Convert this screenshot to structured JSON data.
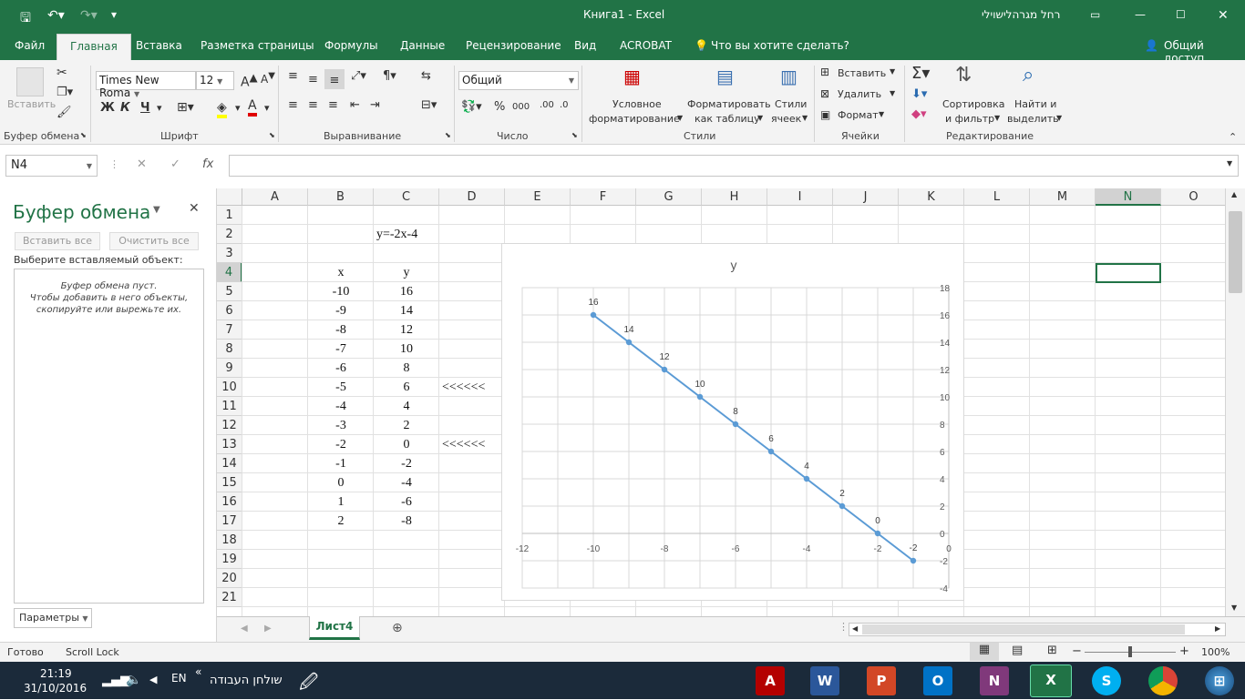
{
  "titlebar": {
    "title": "Книга1  -  Excel",
    "user": "רחל מגרהלישוילי"
  },
  "tabs": [
    "Файл",
    "Главная",
    "Вставка",
    "Разметка страницы",
    "Формулы",
    "Данные",
    "Рецензирование",
    "Вид",
    "ACROBAT"
  ],
  "tell_me": "Что вы хотите сделать?",
  "share": "Общий доступ",
  "ribbon": {
    "paste": "Вставить",
    "font_name": "Times New Roma",
    "font_size": "12",
    "bold": "Ж",
    "italic": "К",
    "underline": "Ч",
    "number_format": "Общий",
    "cond_format_1": "Условное",
    "cond_format_2": "форматирование",
    "format_table_1": "Форматировать",
    "format_table_2": "как таблицу",
    "cell_styles_1": "Стили",
    "cell_styles_2": "ячеек",
    "insert": "Вставить",
    "delete": "Удалить",
    "format": "Формат",
    "sort_1": "Сортировка",
    "sort_2": "и фильтр",
    "find_1": "Найти и",
    "find_2": "выделить",
    "groups": {
      "clipboard": "Буфер обмена",
      "font": "Шрифт",
      "alignment": "Выравнивание",
      "number": "Число",
      "styles": "Стили",
      "cells": "Ячейки",
      "editing": "Редактирование"
    }
  },
  "formula_bar": {
    "name_box": "N4",
    "fx": "fx"
  },
  "pane": {
    "title": "Буфер обмена",
    "paste_all": "Вставить все",
    "clear_all": "Очистить все",
    "choose": "Выберите вставляемый объект:",
    "empty_1": "Буфер обмена пуст.",
    "empty_2": "Чтобы добавить в него объекты,",
    "empty_3": "скопируйте или вырежьте их.",
    "options": "Параметры"
  },
  "columns": [
    "A",
    "B",
    "C",
    "D",
    "E",
    "F",
    "G",
    "H",
    "I",
    "J",
    "K",
    "L",
    "M",
    "N",
    "O"
  ],
  "rows": [
    "1",
    "2",
    "3",
    "4",
    "5",
    "6",
    "7",
    "8",
    "9",
    "10",
    "11",
    "12",
    "13",
    "14",
    "15",
    "16",
    "17",
    "18",
    "19",
    "20",
    "21"
  ],
  "cells": {
    "C2": "y=-2x-4",
    "B4": "x",
    "C4": "y",
    "x_values": [
      "-10",
      "-9",
      "-8",
      "-7",
      "-6",
      "-5",
      "-4",
      "-3",
      "-2",
      "-1",
      "0",
      "1",
      "2"
    ],
    "y_values": [
      "16",
      "14",
      "12",
      "10",
      "8",
      "6",
      "4",
      "2",
      "0",
      "-2",
      "-4",
      "-6",
      "-8"
    ],
    "D10": "<<<<<<",
    "D13": "<<<<<<"
  },
  "chart_data": {
    "type": "line",
    "title": "y",
    "x": [
      -10,
      -9,
      -8,
      -7,
      -6,
      -5,
      -4,
      -3,
      -2,
      -1
    ],
    "series": [
      {
        "values": [
          16,
          14,
          12,
          10,
          8,
          6,
          4,
          2,
          0,
          -2
        ],
        "color": "#5b9bd5"
      }
    ],
    "data_labels": [
      "16",
      "14",
      "12",
      "10",
      "8",
      "6",
      "4",
      "2",
      "0",
      "-2"
    ],
    "xlim": [
      -12,
      0
    ],
    "ylim": [
      -4,
      18
    ],
    "xticks": [
      "-12",
      "-10",
      "-8",
      "-6",
      "-4",
      "-2",
      "0"
    ],
    "yticks": [
      "18",
      "16",
      "14",
      "12",
      "10",
      "8",
      "6",
      "4",
      "2",
      "0",
      "-2",
      "-4"
    ],
    "grid": true
  },
  "sheet_tab": "Лист4",
  "status": {
    "ready": "Готово",
    "scroll_lock": "Scroll Lock",
    "zoom": "100%"
  },
  "taskbar": {
    "time": "21:19",
    "date": "31/10/2016",
    "lang": "EN",
    "desktop": "שולחן העבודה"
  },
  "colors": {
    "accent": "#217346",
    "series": "#5b9bd5"
  }
}
